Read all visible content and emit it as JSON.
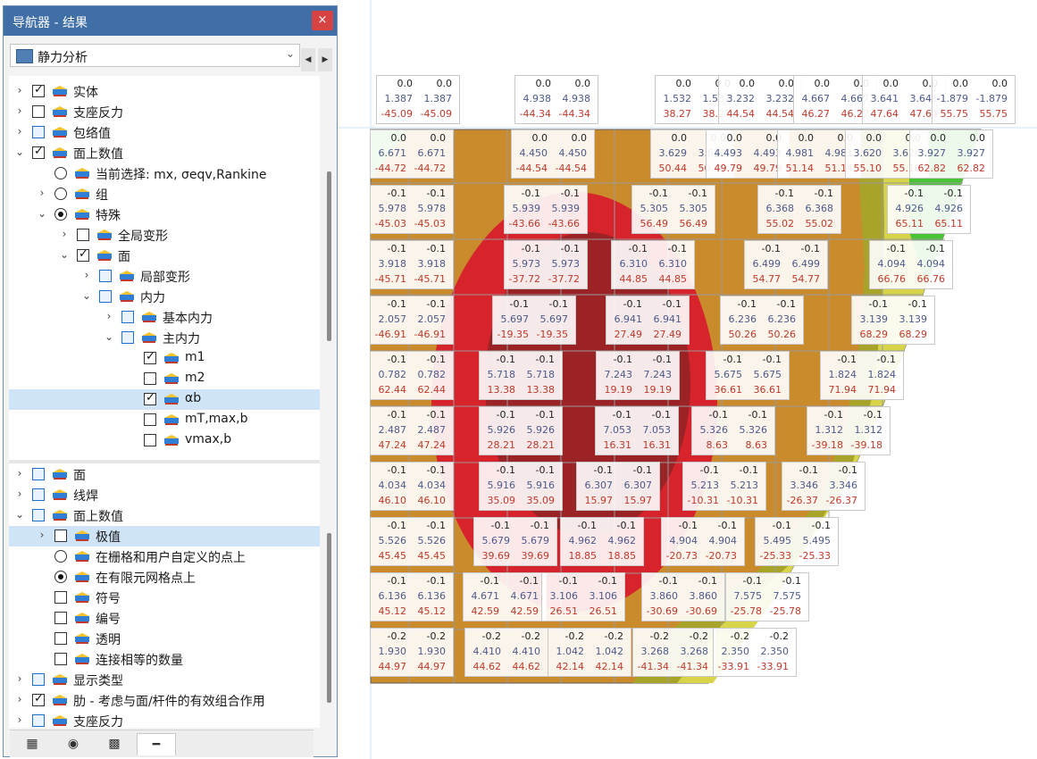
{
  "navigator": {
    "title": "导航器 - 结果",
    "close": "×",
    "dropdown": "静力分析",
    "nav_prev": "◀",
    "nav_next": "▶",
    "tree": [
      {
        "label": "实体",
        "indent": 0,
        "expand": ">",
        "control": "cb",
        "checked": true,
        "icon": "solid-icon"
      },
      {
        "label": "支座反力",
        "indent": 0,
        "expand": ">",
        "control": "cb",
        "checked": false,
        "icon": "support-reaction-icon"
      },
      {
        "label": "包络值",
        "indent": 0,
        "expand": ">",
        "control": "cb-blue",
        "checked": false,
        "icon": "envelope-icon"
      },
      {
        "label": "面上数值",
        "indent": 0,
        "expand": "v",
        "control": "cb",
        "checked": true,
        "icon": "surface-values-icon"
      },
      {
        "label": "当前选择: mx, σeqv,Rankine",
        "indent": 1,
        "expand": "",
        "control": "radio",
        "checked": false,
        "icon": "xx-icon"
      },
      {
        "label": "组",
        "indent": 1,
        "expand": ">",
        "control": "radio",
        "checked": false,
        "icon": "xx-icon"
      },
      {
        "label": "特殊",
        "indent": 1,
        "expand": "v",
        "control": "radio",
        "checked": true,
        "icon": "xx-icon"
      },
      {
        "label": "全局变形",
        "indent": 2,
        "expand": ">",
        "control": "cb",
        "checked": false,
        "icon": "deformation-icon"
      },
      {
        "label": "面",
        "indent": 2,
        "expand": "v",
        "control": "cb",
        "checked": true,
        "icon": "surface-icon"
      },
      {
        "label": "局部变形",
        "indent": 3,
        "expand": ">",
        "control": "cb-blue",
        "checked": false,
        "icon": "surface-icon"
      },
      {
        "label": "内力",
        "indent": 3,
        "expand": "v",
        "control": "cb-blue",
        "checked": false,
        "icon": "surface-icon"
      },
      {
        "label": "基本内力",
        "indent": 4,
        "expand": ">",
        "control": "cb-blue",
        "checked": false,
        "icon": "surface-icon"
      },
      {
        "label": "主内力",
        "indent": 4,
        "expand": "v",
        "control": "cb-blue",
        "checked": false,
        "icon": "surface-icon"
      },
      {
        "label": "m1",
        "indent": 5,
        "expand": "",
        "control": "cb",
        "checked": true,
        "icon": "surface-icon"
      },
      {
        "label": "m2",
        "indent": 5,
        "expand": "",
        "control": "cb",
        "checked": false,
        "icon": "surface-icon"
      },
      {
        "label": "αb",
        "indent": 5,
        "expand": "",
        "control": "cb",
        "checked": true,
        "icon": "surface-icon",
        "selected": true
      },
      {
        "label": "mT,max,b",
        "indent": 5,
        "expand": "",
        "control": "cb",
        "checked": false,
        "icon": "surface-icon"
      },
      {
        "label": "vmax,b",
        "indent": 5,
        "expand": "",
        "control": "cb",
        "checked": false,
        "icon": "surface-icon"
      }
    ],
    "tree2": [
      {
        "label": "面",
        "indent": 0,
        "expand": ">",
        "control": "cb-blue",
        "checked": false,
        "icon": "display-surface-icon"
      },
      {
        "label": "线焊",
        "indent": 0,
        "expand": ">",
        "control": "cb-blue",
        "checked": false,
        "icon": "display-weld-icon"
      },
      {
        "label": "面上数值",
        "indent": 0,
        "expand": "v",
        "control": "cb-blue",
        "checked": false,
        "icon": "display-values-icon"
      },
      {
        "label": "极值",
        "indent": 1,
        "expand": ">",
        "control": "cb",
        "checked": false,
        "icon": "display-extreme-icon",
        "selected": true
      },
      {
        "label": "在栅格和用户自定义的点上",
        "indent": 1,
        "expand": "",
        "control": "radio",
        "checked": false,
        "icon": "display-grid-icon"
      },
      {
        "label": "在有限元网格点上",
        "indent": 1,
        "expand": "",
        "control": "radio",
        "checked": true,
        "icon": "display-fe-icon"
      },
      {
        "label": "符号",
        "indent": 1,
        "expand": "",
        "control": "cb",
        "checked": false,
        "icon": "display-symbol-icon"
      },
      {
        "label": "编号",
        "indent": 1,
        "expand": "",
        "control": "cb",
        "checked": false,
        "icon": "display-number-icon"
      },
      {
        "label": "透明",
        "indent": 1,
        "expand": "",
        "control": "cb",
        "checked": false,
        "icon": "display-transparent-icon"
      },
      {
        "label": "连接相等的数量",
        "indent": 1,
        "expand": "",
        "control": "cb",
        "checked": false,
        "icon": "display-connect-icon"
      },
      {
        "label": "显示类型",
        "indent": 0,
        "expand": ">",
        "control": "cb-blue",
        "checked": false,
        "icon": "display-type-icon"
      },
      {
        "label": "肋 - 考虑与面/杆件的有效组合作用",
        "indent": 0,
        "expand": ">",
        "control": "cb",
        "checked": true,
        "icon": "display-rib-icon"
      },
      {
        "label": "支座反力",
        "indent": 0,
        "expand": ">",
        "control": "cb-blue",
        "checked": false,
        "icon": "display-support-icon"
      }
    ],
    "tabs": [
      "data-tab-icon",
      "eye-icon",
      "camera-icon",
      "results-tab-icon"
    ]
  },
  "colors": {
    "accent": "#3f6fa6",
    "selection": "#cfe4f6",
    "red": "#d7232b",
    "darkred": "#9b2225",
    "orange": "#c98b2b",
    "olive": "#a8a42a",
    "yellow": "#d8d44a",
    "green": "#4bc336"
  },
  "value_boxes": [
    {
      "cells": [
        "0.0",
        "0.0",
        "1.387",
        "1.387",
        "-45.09",
        "-45.09"
      ]
    },
    {
      "cells": [
        "0.0",
        "0.0",
        "4.938",
        "4.938",
        "-44.34",
        "-44.34"
      ]
    },
    {
      "cells": [
        "0.0",
        "0.0",
        "1.532",
        "1.532",
        "38.27",
        "38.27"
      ]
    },
    {
      "cells": [
        "0.0",
        "0.0",
        "3.232",
        "3.232",
        "44.54",
        "44.54"
      ]
    },
    {
      "cells": [
        "0.0",
        "0.0",
        "4.667",
        "4.667",
        "46.27",
        "46.27"
      ]
    },
    {
      "cells": [
        "0.0",
        "0.0",
        "3.641",
        "3.641",
        "47.64",
        "47.64"
      ]
    },
    {
      "cells": [
        "0.0",
        "0.0",
        "-1.879",
        "-1.879",
        "55.75",
        "55.75"
      ]
    },
    {
      "cells": [
        "0.0",
        "0.0",
        "6.671",
        "6.671",
        "-44.72",
        "-44.72"
      ]
    },
    {
      "cells": [
        "0.0",
        "0.0",
        "4.450",
        "4.450",
        "-44.54",
        "-44.54"
      ]
    },
    {
      "cells": [
        "0.0",
        "0.0",
        "3.629",
        "3.629",
        "50.44",
        "50.44"
      ]
    },
    {
      "cells": [
        "0.0",
        "0.0",
        "4.493",
        "4.493",
        "49.79",
        "49.79"
      ]
    },
    {
      "cells": [
        "0.0",
        "0.0",
        "4.981",
        "4.981",
        "51.14",
        "51.14"
      ]
    },
    {
      "cells": [
        "0.0",
        "0.0",
        "3.620",
        "3.620",
        "55.10",
        "55.10"
      ]
    },
    {
      "cells": [
        "0.0",
        "0.0",
        "3.927",
        "3.927",
        "62.82",
        "62.82"
      ]
    },
    {
      "cells": [
        "-0.1",
        "-0.1",
        "5.978",
        "5.978",
        "-45.03",
        "-45.03"
      ]
    },
    {
      "cells": [
        "-0.1",
        "-0.1",
        "5.939",
        "5.939",
        "-43.66",
        "-43.66"
      ]
    },
    {
      "cells": [
        "-0.1",
        "-0.1",
        "5.305",
        "5.305",
        "56.49",
        "56.49"
      ]
    },
    {
      "cells": [
        "-0.1",
        "-0.1",
        "6.368",
        "6.368",
        "55.02",
        "55.02"
      ]
    },
    {
      "cells": [
        "-0.1",
        "-0.1",
        "4.926",
        "4.926",
        "65.11",
        "65.11"
      ]
    },
    {
      "cells": [
        "-0.1",
        "-0.1",
        "3.918",
        "3.918",
        "-45.71",
        "-45.71"
      ]
    },
    {
      "cells": [
        "-0.1",
        "-0.1",
        "5.973",
        "5.973",
        "-37.72",
        "-37.72"
      ]
    },
    {
      "cells": [
        "-0.1",
        "-0.1",
        "6.310",
        "6.310",
        "44.85",
        "44.85"
      ]
    },
    {
      "cells": [
        "-0.1",
        "-0.1",
        "6.499",
        "6.499",
        "54.77",
        "54.77"
      ]
    },
    {
      "cells": [
        "-0.1",
        "-0.1",
        "4.094",
        "4.094",
        "66.76",
        "66.76"
      ]
    },
    {
      "cells": [
        "-0.1",
        "-0.1",
        "2.057",
        "2.057",
        "-46.91",
        "-46.91"
      ]
    },
    {
      "cells": [
        "-0.1",
        "-0.1",
        "5.697",
        "5.697",
        "-19.35",
        "-19.35"
      ]
    },
    {
      "cells": [
        "-0.1",
        "-0.1",
        "6.941",
        "6.941",
        "27.49",
        "27.49"
      ]
    },
    {
      "cells": [
        "-0.1",
        "-0.1",
        "6.236",
        "6.236",
        "50.26",
        "50.26"
      ]
    },
    {
      "cells": [
        "-0.1",
        "-0.1",
        "3.139",
        "3.139",
        "68.29",
        "68.29"
      ]
    },
    {
      "cells": [
        "-0.1",
        "-0.1",
        "0.782",
        "0.782",
        "62.44",
        "62.44"
      ]
    },
    {
      "cells": [
        "-0.1",
        "-0.1",
        "5.718",
        "5.718",
        "13.38",
        "13.38"
      ]
    },
    {
      "cells": [
        "-0.1",
        "-0.1",
        "7.243",
        "7.243",
        "19.19",
        "19.19"
      ]
    },
    {
      "cells": [
        "-0.1",
        "-0.1",
        "5.675",
        "5.675",
        "36.61",
        "36.61"
      ]
    },
    {
      "cells": [
        "-0.1",
        "-0.1",
        "1.824",
        "1.824",
        "71.94",
        "71.94"
      ]
    },
    {
      "cells": [
        "-0.1",
        "-0.1",
        "2.487",
        "2.487",
        "47.24",
        "47.24"
      ]
    },
    {
      "cells": [
        "-0.1",
        "-0.1",
        "5.926",
        "5.926",
        "28.21",
        "28.21"
      ]
    },
    {
      "cells": [
        "-0.1",
        "-0.1",
        "7.053",
        "7.053",
        "16.31",
        "16.31"
      ]
    },
    {
      "cells": [
        "-0.1",
        "-0.1",
        "5.326",
        "5.326",
        "8.63",
        "8.63"
      ]
    },
    {
      "cells": [
        "-0.1",
        "-0.1",
        "1.312",
        "1.312",
        "-39.18",
        "-39.18"
      ]
    },
    {
      "cells": [
        "-0.1",
        "-0.1",
        "4.034",
        "4.034",
        "46.10",
        "46.10"
      ]
    },
    {
      "cells": [
        "-0.1",
        "-0.1",
        "5.916",
        "5.916",
        "35.09",
        "35.09"
      ]
    },
    {
      "cells": [
        "-0.1",
        "-0.1",
        "6.307",
        "6.307",
        "15.97",
        "15.97"
      ]
    },
    {
      "cells": [
        "-0.1",
        "-0.1",
        "5.213",
        "5.213",
        "-10.31",
        "-10.31"
      ]
    },
    {
      "cells": [
        "-0.1",
        "-0.1",
        "3.346",
        "3.346",
        "-26.37",
        "-26.37"
      ]
    },
    {
      "cells": [
        "-0.1",
        "-0.1",
        "5.526",
        "5.526",
        "45.45",
        "45.45"
      ]
    },
    {
      "cells": [
        "-0.1",
        "-0.1",
        "5.679",
        "5.679",
        "39.69",
        "39.69"
      ]
    },
    {
      "cells": [
        "-0.1",
        "-0.1",
        "4.962",
        "4.962",
        "18.85",
        "18.85"
      ]
    },
    {
      "cells": [
        "-0.1",
        "-0.1",
        "4.904",
        "4.904",
        "-20.73",
        "-20.73"
      ]
    },
    {
      "cells": [
        "-0.1",
        "-0.1",
        "5.495",
        "5.495",
        "-25.33",
        "-25.33"
      ]
    },
    {
      "cells": [
        "-0.1",
        "-0.1",
        "6.136",
        "6.136",
        "45.12",
        "45.12"
      ]
    },
    {
      "cells": [
        "-0.1",
        "-0.1",
        "4.671",
        "4.671",
        "42.59",
        "42.59"
      ]
    },
    {
      "cells": [
        "-0.1",
        "-0.1",
        "3.106",
        "3.106",
        "26.51",
        "26.51"
      ]
    },
    {
      "cells": [
        "-0.1",
        "-0.1",
        "3.860",
        "3.860",
        "-30.69",
        "-30.69"
      ]
    },
    {
      "cells": [
        "-0.1",
        "-0.1",
        "7.575",
        "7.575",
        "-25.78",
        "-25.78"
      ]
    },
    {
      "cells": [
        "-0.2",
        "-0.2",
        "1.930",
        "1.930",
        "44.97",
        "44.97"
      ]
    },
    {
      "cells": [
        "-0.2",
        "-0.2",
        "4.410",
        "4.410",
        "44.62",
        "44.62"
      ]
    },
    {
      "cells": [
        "-0.2",
        "-0.2",
        "1.042",
        "1.042",
        "42.14",
        "42.14"
      ]
    },
    {
      "cells": [
        "-0.2",
        "-0.2",
        "3.268",
        "3.268",
        "-41.34",
        "-41.34"
      ]
    },
    {
      "cells": [
        "-0.2",
        "-0.2",
        "2.350",
        "2.350",
        "-33.91",
        "-33.91"
      ]
    }
  ]
}
